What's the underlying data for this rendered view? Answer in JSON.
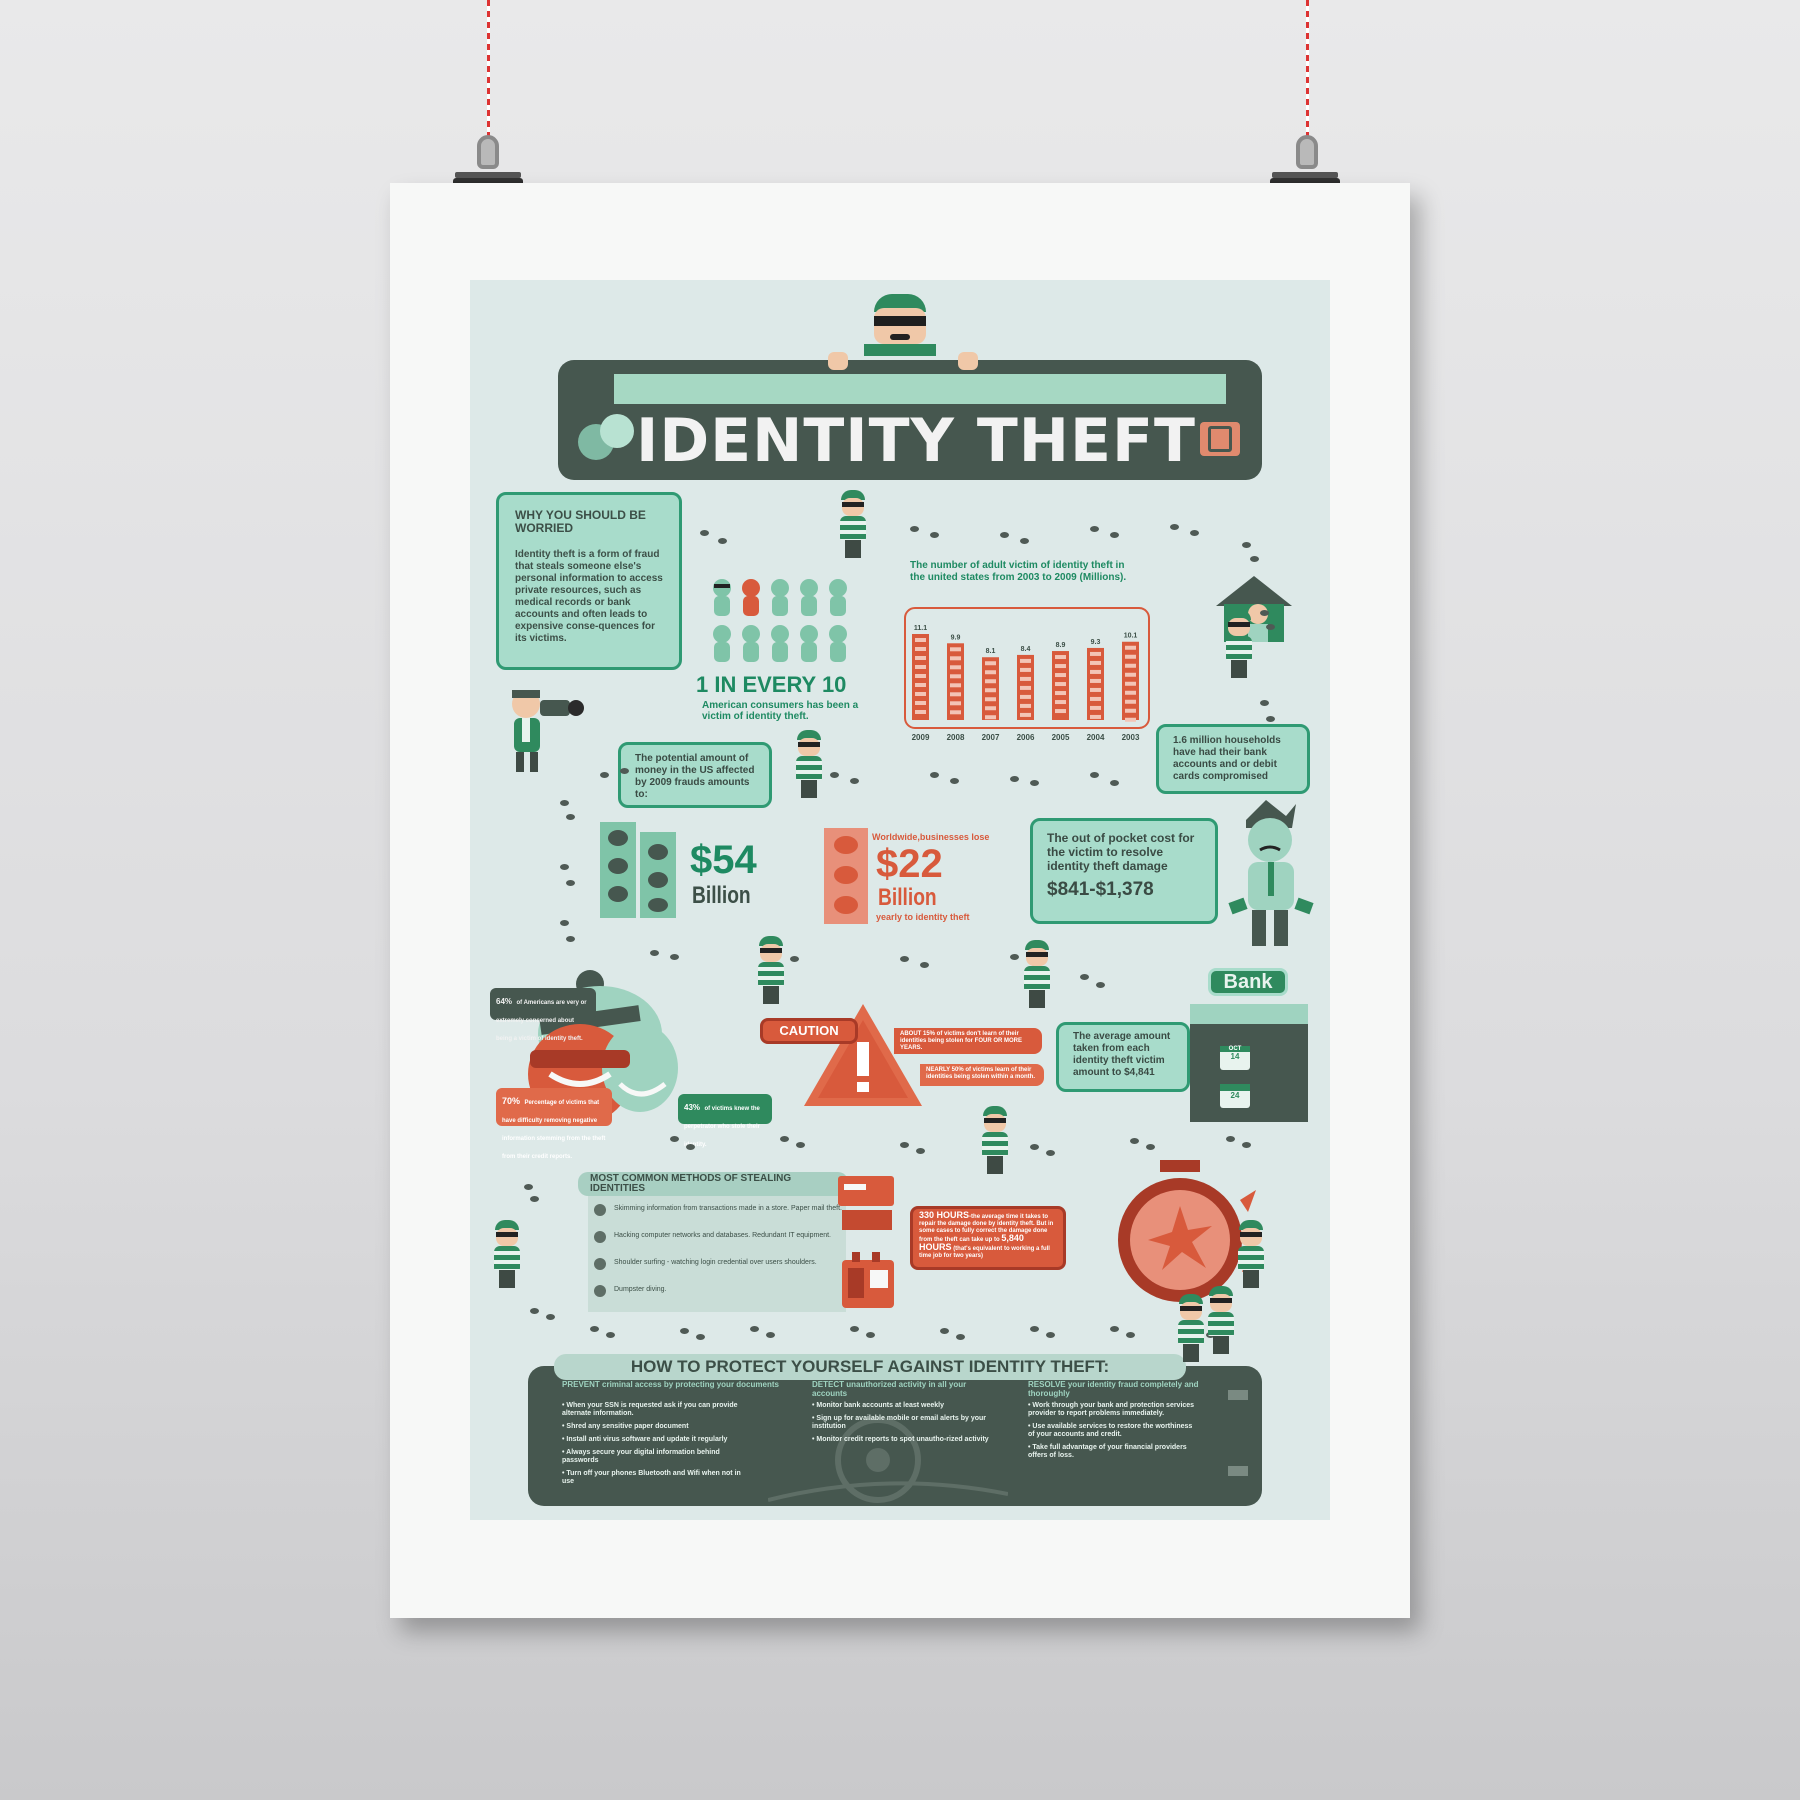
{
  "title": "IDENTITY THEFT",
  "worried": {
    "heading": "WHY YOU SHOULD BE WORRIED",
    "body": "Identity theft is a form of fraud that steals someone else's personal information to access private resources, such as medical records or bank accounts and often leads to expensive conse-quences for its victims."
  },
  "ratio": {
    "headline": "1 IN EVERY 10",
    "caption": "American consumers has been a victim of identity theft."
  },
  "chart_title": "The number of adult victim of identity theft in the united states from 2003 to 2009 (Millions).",
  "chart_data": {
    "type": "bar",
    "categories": [
      "2009",
      "2008",
      "2007",
      "2006",
      "2005",
      "2004",
      "2003"
    ],
    "values": [
      11.1,
      9.9,
      8.1,
      8.4,
      8.9,
      9.3,
      10.1
    ],
    "title": "The number of adult victim of identity theft in the united states from 2003 to 2009 (Millions).",
    "xlabel": "",
    "ylabel": "",
    "colors": {
      "bar": "#d85a3c",
      "frame": "#d85a3c"
    }
  },
  "households": "1.6 million households have had their bank accounts and or debit cards compromised",
  "potential": "The potential amount of money in the US affected by 2009 frauds amounts to:",
  "us_amount": {
    "value": "$54",
    "unit": "Billion"
  },
  "worldwide": {
    "lead": "Worldwide,businesses lose",
    "value": "$22",
    "unit": "Billion",
    "tail": "yearly to identity theft"
  },
  "pocket": {
    "text": "The out of pocket cost for the victim to resolve identity theft damage",
    "range": "$841-$1,378"
  },
  "concern": {
    "pct": "64%",
    "text": "of Americans are very or extremely concerned about being a victim of identity theft."
  },
  "difficulty": {
    "pct": "70%",
    "text": "Percentage of victims that have difficulty removing negative information stemming from the theft from their credit reports."
  },
  "knew": {
    "pct": "43%",
    "text": "of victims knew the perpetrator who stole their identity."
  },
  "caution": {
    "label": "CAUTION",
    "note1": "ABOUT 15% of victims don't learn of their identities being stolen for FOUR OR MORE YEARS.",
    "note2": "NEARLY 50% of victims learn of their identities being stolen within a month."
  },
  "bank": {
    "label": "Bank",
    "text": "The average amount taken from each identity theft victim amount to $4,841",
    "cal1": "14",
    "cal2": "24",
    "cal_month": "OCT"
  },
  "methods": {
    "heading": "MOST COMMON METHODS OF STEALING IDENTITIES",
    "items": [
      "Skimming information from transactions made in a store. Paper mail theft.",
      "Hacking computer networks and databases. Redundant IT equipment.",
      "Shoulder surfing - watching login credential over users shoulders.",
      "Dumpster diving."
    ]
  },
  "hours": {
    "lead": "330 HOURS",
    "text1": "-the average time it takes to repair the damage done by identity theft. But in some cases to fully correct the damage done from the theft can take up to",
    "lead2": "5,840 HOURS",
    "text2": "(that's equivalent to working a full time job for two years)"
  },
  "protect": {
    "heading": "HOW TO PROTECT YOURSELF AGAINST IDENTITY THEFT:",
    "col1_title": "PREVENT criminal access by protecting your documents",
    "col1": [
      "When your SSN is requested ask if you can provide alternate information.",
      "Shred any sensitive paper document",
      "Install anti virus software and update it regularly",
      "Always secure your digital information behind passwords",
      "Turn off your phones Bluetooth and Wifi when not in use"
    ],
    "col2_title": "DETECT unauthorized activity in all your accounts",
    "col2": [
      "Monitor bank accounts at least weekly",
      "Sign up for available mobile or email alerts by your institution",
      "Monitor credit reports to spot unautho-rized activity"
    ],
    "col3_title": "RESOLVE your identity fraud completely and thoroughly",
    "col3": [
      "Work through your bank and protection services provider to report problems immediately.",
      "Use available services to restore the worthiness of your accounts and credit.",
      "Take full advantage of your financial providers offers of loss."
    ]
  }
}
